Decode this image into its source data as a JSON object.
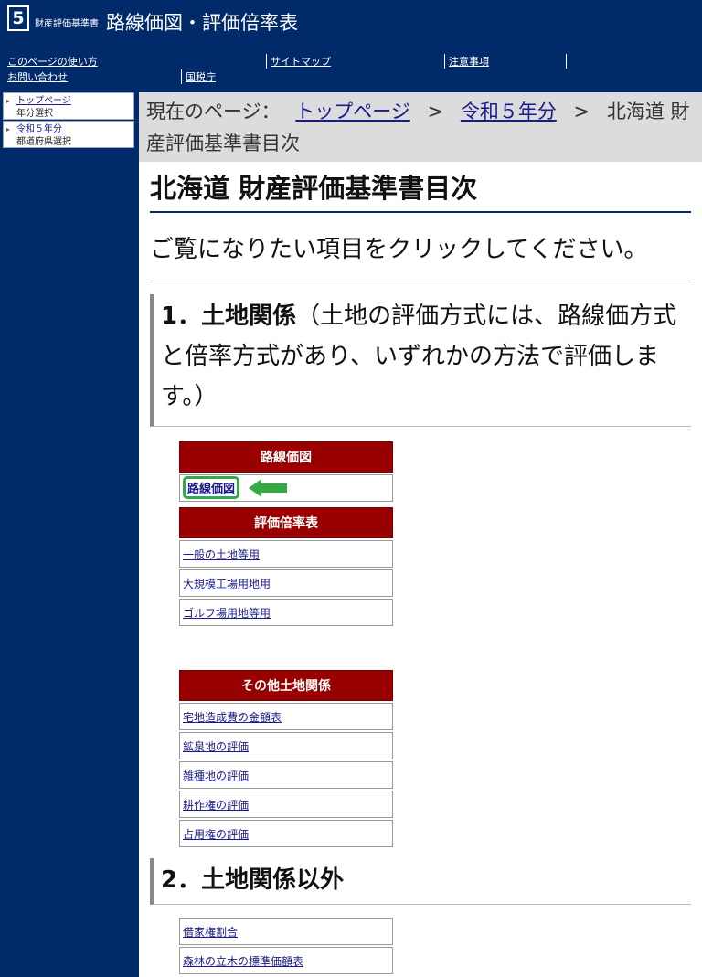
{
  "header": {
    "logo_number": "5",
    "logo_small": "財産評価基準書",
    "title": "路線価図・評価倍率表",
    "links": [
      "このページの使い方",
      "サイトマップ",
      "注意事項",
      "お問い合わせ",
      "国税庁"
    ]
  },
  "sidebar": {
    "items": [
      {
        "link": "トップページ",
        "sub": "年分選択"
      },
      {
        "link": "令和５年分",
        "sub": "都道府県選択"
      }
    ]
  },
  "breadcrumb": {
    "prefix": "現在のページ：",
    "link1": "トップページ",
    "sep": ">",
    "link2": "令和５年分",
    "current": "北海道 財産評価基準書目次"
  },
  "page_title": "北海道 財産評価基準書目次",
  "lead": "ご覧になりたい項目をクリックしてください。",
  "section1": {
    "heading": "1．土地関係",
    "note": "（土地の評価方式には、路線価方式と倍率方式があり、いずれかの方法で評価します。）"
  },
  "section2": {
    "heading": "2．土地関係以外"
  },
  "tables": {
    "rosenka": {
      "header": "路線価図",
      "items": [
        "路線価図"
      ]
    },
    "bairitsu": {
      "header": "評価倍率表",
      "items": [
        "一般の土地等用",
        "大規模工場用地用",
        "ゴルフ場用地等用"
      ]
    },
    "sonota": {
      "header": "その他土地関係",
      "items": [
        "宅地造成費の金額表",
        "鉱泉地の評価",
        "雑種地の評価",
        "耕作権の評価",
        "占用権の評価"
      ]
    },
    "igai": {
      "items": [
        "借家権割合",
        "森林の立木の標準価額表"
      ]
    }
  },
  "colors": {
    "navy": "#002a6a",
    "table_header": "#990000",
    "highlight": "#33aa44"
  }
}
